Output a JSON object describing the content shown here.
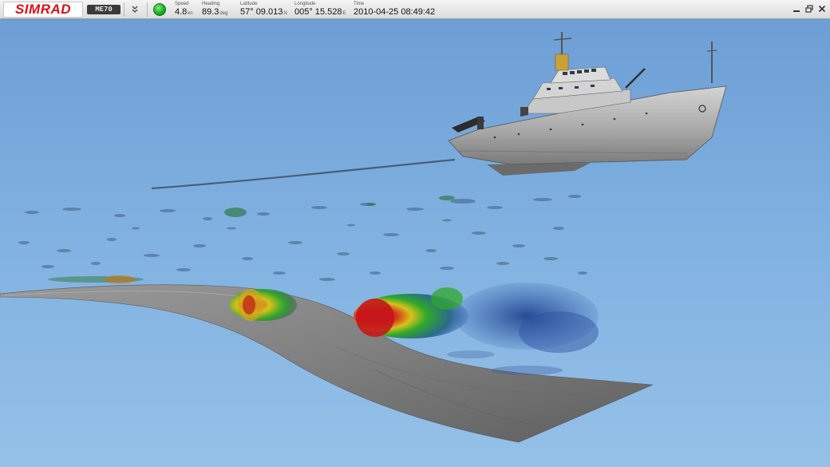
{
  "app": {
    "brand": "SIMRAD",
    "product_badge": "ME70"
  },
  "status": {
    "indicator_color": "#18b51c",
    "fields": [
      {
        "label": "Speed",
        "value": "4.8",
        "unit": "kn"
      },
      {
        "label": "Heading",
        "value": "89.3",
        "unit": "deg"
      },
      {
        "label": "Latitude",
        "value": "57° 09.013",
        "unit": "N"
      },
      {
        "label": "Longitude",
        "value": "005° 15.528",
        "unit": "E"
      },
      {
        "label": "Time",
        "value": "2010-04-25 08:49:42",
        "unit": ""
      }
    ]
  },
  "icons": {
    "menu": "chevrons-down-icon",
    "minimize": "minimize-icon",
    "restore": "restore-icon",
    "close": "close-icon"
  },
  "colors": {
    "brand_red": "#d8101b",
    "sky_top": "#6d9ed5",
    "sky_bottom": "#95c1e8",
    "seabed": "#8d8d8d",
    "echo_strong": "#d81e14",
    "echo_medium": "#2fa82a",
    "echo_weak": "#2a4fa0"
  }
}
